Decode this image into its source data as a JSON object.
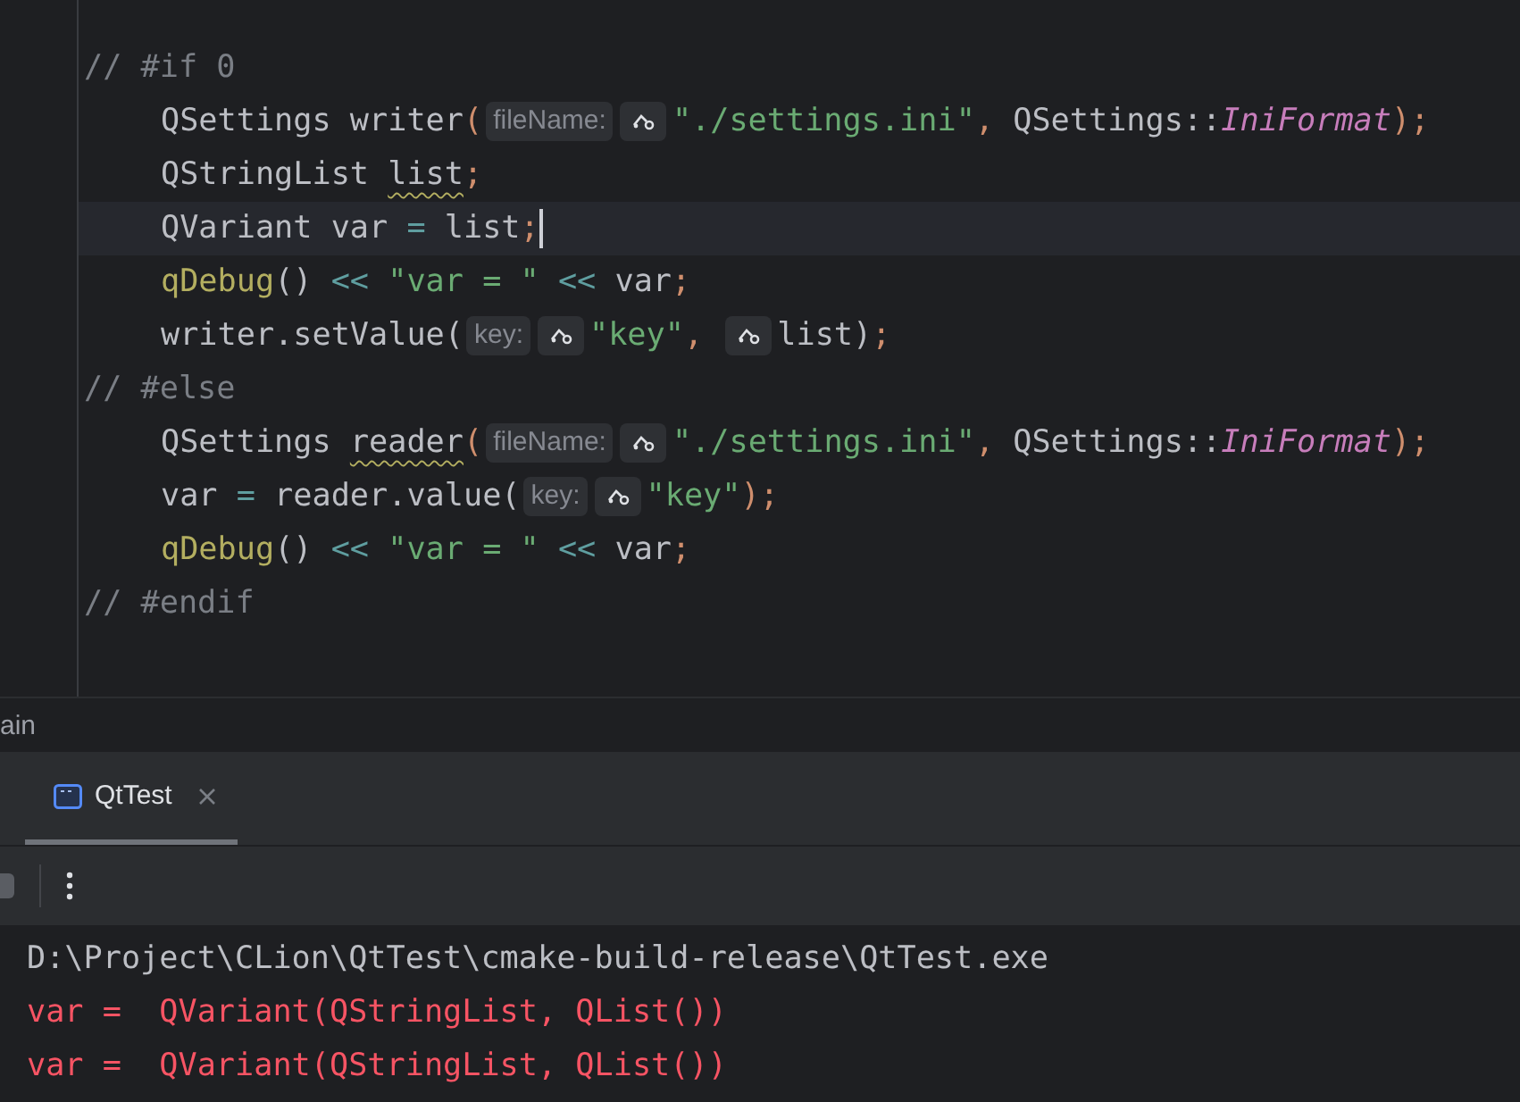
{
  "editor": {
    "lines": [
      {
        "indented": false,
        "current": false,
        "tokens": [
          {
            "kind": "comment",
            "text": "// #if 0"
          }
        ]
      },
      {
        "indented": true,
        "current": false,
        "tokens": [
          {
            "kind": "plain",
            "text": "QSettings writer"
          },
          {
            "kind": "punct",
            "text": "("
          },
          {
            "kind": "hint",
            "text": "fileName:"
          },
          {
            "kind": "string",
            "text": "\"./settings.ini\""
          },
          {
            "kind": "punct",
            "text": ", "
          },
          {
            "kind": "plain",
            "text": "QSettings::"
          },
          {
            "kind": "enum",
            "text": "IniFormat"
          },
          {
            "kind": "punct",
            "text": ");"
          }
        ]
      },
      {
        "indented": true,
        "current": false,
        "tokens": [
          {
            "kind": "plain",
            "text": "QStringList "
          },
          {
            "kind": "warning",
            "text": "list"
          },
          {
            "kind": "punct",
            "text": ";"
          }
        ]
      },
      {
        "indented": true,
        "current": true,
        "tokens": [
          {
            "kind": "plain",
            "text": "QVariant var "
          },
          {
            "kind": "op",
            "text": "="
          },
          {
            "kind": "plain",
            "text": " list"
          },
          {
            "kind": "punct",
            "text": ";"
          }
        ]
      },
      {
        "indented": true,
        "current": false,
        "tokens": [
          {
            "kind": "func",
            "text": "qDebug"
          },
          {
            "kind": "plain",
            "text": "() "
          },
          {
            "kind": "op",
            "text": "<<"
          },
          {
            "kind": "string",
            "text": " \"var = \" "
          },
          {
            "kind": "op",
            "text": "<<"
          },
          {
            "kind": "plain",
            "text": " var"
          },
          {
            "kind": "punct",
            "text": ";"
          }
        ]
      },
      {
        "indented": true,
        "current": false,
        "tokens": [
          {
            "kind": "plain",
            "text": "writer.setValue("
          },
          {
            "kind": "hint",
            "text": "key:"
          },
          {
            "kind": "string",
            "text": "\"key\""
          },
          {
            "kind": "punct",
            "text": ", "
          },
          {
            "kind": "hint"
          },
          {
            "kind": "plain",
            "text": "list)"
          },
          {
            "kind": "punct",
            "text": ";"
          }
        ]
      },
      {
        "indented": false,
        "current": false,
        "tokens": [
          {
            "kind": "comment",
            "text": "// #else"
          }
        ]
      },
      {
        "indented": true,
        "current": false,
        "tokens": [
          {
            "kind": "plain",
            "text": "QSettings "
          },
          {
            "kind": "warning",
            "text": "reader"
          },
          {
            "kind": "punct",
            "text": "("
          },
          {
            "kind": "hint",
            "text": "fileName:"
          },
          {
            "kind": "string",
            "text": "\"./settings.ini\""
          },
          {
            "kind": "punct",
            "text": ", "
          },
          {
            "kind": "plain",
            "text": "QSettings::"
          },
          {
            "kind": "enum",
            "text": "IniFormat"
          },
          {
            "kind": "punct",
            "text": ");"
          }
        ]
      },
      {
        "indented": true,
        "current": false,
        "tokens": [
          {
            "kind": "plain",
            "text": "var "
          },
          {
            "kind": "op",
            "text": "="
          },
          {
            "kind": "plain",
            "text": " reader.value("
          },
          {
            "kind": "hint",
            "text": "key:"
          },
          {
            "kind": "string",
            "text": "\"key\""
          },
          {
            "kind": "punct",
            "text": ");"
          }
        ]
      },
      {
        "indented": true,
        "current": false,
        "tokens": [
          {
            "kind": "func",
            "text": "qDebug"
          },
          {
            "kind": "plain",
            "text": "() "
          },
          {
            "kind": "op",
            "text": "<<"
          },
          {
            "kind": "string",
            "text": " \"var = \" "
          },
          {
            "kind": "op",
            "text": "<<"
          },
          {
            "kind": "plain",
            "text": " var"
          },
          {
            "kind": "punct",
            "text": ";"
          }
        ]
      },
      {
        "indented": false,
        "current": false,
        "tokens": [
          {
            "kind": "comment",
            "text": "// #endif"
          }
        ]
      }
    ]
  },
  "breadcrumb": "ain",
  "run_panel": {
    "tabs": [
      {
        "label": "QtTest",
        "selected": true
      }
    ]
  },
  "console": {
    "lines": [
      {
        "kind": "path",
        "text": "D:\\Project\\CLion\\QtTest\\cmake-build-release\\QtTest.exe"
      },
      {
        "kind": "error",
        "text": "var =  QVariant(QStringList, QList())"
      },
      {
        "kind": "error",
        "text": "var =  QVariant(QStringList, QList())"
      }
    ]
  }
}
